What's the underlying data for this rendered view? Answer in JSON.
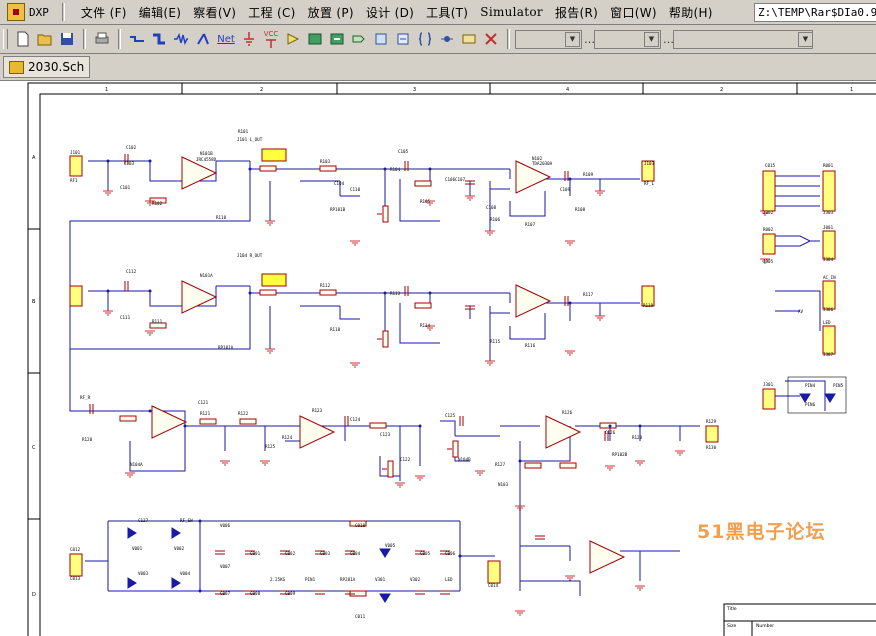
{
  "app": {
    "name": "DXP"
  },
  "menu": {
    "items": [
      "文件 (F)",
      "编辑(E)",
      "察看(V)",
      "工程 (C)",
      "放置 (P)",
      "设计 (D)",
      "工具(T)",
      "Simulator",
      "报告(R)",
      "窗口(W)",
      "帮助(H)"
    ]
  },
  "path": {
    "text": "Z:\\TEMP\\Rar$DIa0.928"
  },
  "toolbar": {
    "icons": [
      "new-icon",
      "open-icon",
      "save-icon",
      "print-icon",
      "wire-icon",
      "bus-icon",
      "bus-entry-icon",
      "net-label-icon",
      "net-icon",
      "ground-icon",
      "vcc-icon",
      "part-icon",
      "sheet-symbol-icon",
      "sheet-entry-icon",
      "port-icon",
      "junction-icon",
      "no-erc-icon",
      "directive-icon",
      "harness-icon",
      "image-icon",
      "cross-icon"
    ],
    "net_text": "Net",
    "vcc_text": "VCC"
  },
  "tabs": {
    "active": "2030.Sch"
  },
  "schematic": {
    "col_numbers": [
      "1",
      "2",
      "3",
      "4",
      "2",
      "1"
    ],
    "row_letters": [
      "A",
      "B",
      "C",
      "D"
    ],
    "labels": [
      "J101",
      "RF1",
      "C101",
      "C102",
      "C103",
      "N101B",
      "R101",
      "R102",
      "JRC4558D",
      "J101 L_OUT",
      "R103",
      "R104",
      "R105",
      "R106",
      "R107",
      "R108",
      "R109",
      "C104",
      "C105",
      "C106",
      "C107",
      "C108",
      "C109",
      "N102",
      "TDA2030A",
      "J103",
      "RF_L",
      "RP101B",
      "R110",
      "C110",
      "J104 R_OUT",
      "C111",
      "C112",
      "N101A",
      "R111",
      "R112",
      "R113",
      "R114",
      "R115",
      "R116",
      "R117",
      "R118",
      "R119",
      "RP101A",
      "RF_R",
      "R120",
      "C121",
      "R121",
      "N104A",
      "R122",
      "R123",
      "R124",
      "R125",
      "C122",
      "C123",
      "C124",
      "N104B",
      "C125",
      "R126",
      "RP102B",
      "R127",
      "N103",
      "C126",
      "R128",
      "R129",
      "R130",
      "C127",
      "RF_SW",
      "V001",
      "V002",
      "V003",
      "V004",
      "V005",
      "V006",
      "V007",
      "C001",
      "C002",
      "C003",
      "C004",
      "C005",
      "C006",
      "C007",
      "C008",
      "C009",
      "C010",
      "C011",
      "C012",
      "C013",
      "C014",
      "C015",
      "R001",
      "R002",
      "J001",
      "AC_IN",
      "LED",
      "J301",
      "J302",
      "J303",
      "J304",
      "J305",
      "J306",
      "J307",
      "AV",
      "PIN4",
      "PIN5",
      "PIN6",
      "2.25KG",
      "PIN1",
      "RP201A",
      "V301",
      "V302",
      "LED"
    ],
    "title_block": {
      "title_label": "Title",
      "size_label": "Size",
      "number_label": "Number"
    }
  },
  "watermark": {
    "text": "51黑电子论坛"
  },
  "colors": {
    "wire": "#1a1aa8",
    "component": "#a00000",
    "ground": "#d03030",
    "border": "#000000",
    "window": "#d4d0c8"
  }
}
